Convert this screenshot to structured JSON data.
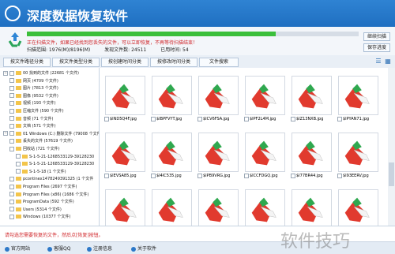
{
  "app": {
    "title": "深度数据恢复软件"
  },
  "scan": {
    "status_text": "正在扫描文件，如果已经找到您丢失的文件，可以立即恢复，不再等待扫描结束！",
    "progress_fraction": 0.75,
    "scanned_label": "扫描范围: 1976(M)/8196(M)",
    "found_label": "发现文件数: 24511",
    "time_label": "已用时间: 54",
    "stop_button": "继续扫描",
    "save_button": "保存进度"
  },
  "tabs": [
    "按文件路径分类",
    "按文件类型分类",
    "按创建时间分类",
    "按修改时间分类",
    "文件搜索"
  ],
  "tree": [
    {
      "label": "00 找到的文件  (22681 个文件)",
      "level": 0,
      "expanded": true
    },
    {
      "label": "网页  (4709 个文件)",
      "level": 1
    },
    {
      "label": "图片  (7813 个文件)",
      "level": 1
    },
    {
      "label": "图像  (9532 个文件)",
      "level": 1
    },
    {
      "label": "视频  (193 个文件)",
      "level": 1
    },
    {
      "label": "压缩文件  (590 个文件)",
      "level": 1
    },
    {
      "label": "音频  (71 个文件)",
      "level": 1
    },
    {
      "label": "文档  (571 个文件)",
      "level": 1
    },
    {
      "label": "01 Windows (C:) 删除文件 (79008 个文件)",
      "level": 0,
      "expanded": true
    },
    {
      "label": "丢失的文件  (57619 个文件)",
      "level": 1
    },
    {
      "label": "回收站  (721 个文件)",
      "level": 1
    },
    {
      "label": "S-1-5-21-1268533129-39128230",
      "level": 2
    },
    {
      "label": "S-1-5-21-1268533129-39128230",
      "level": 2
    },
    {
      "label": "S-1-5-18  (1 个文件)",
      "level": 2
    },
    {
      "label": "pcontinex1478249391325  (1 个文件",
      "level": 1
    },
    {
      "label": "Program Files  (2697 个文件)",
      "level": 1
    },
    {
      "label": "Program Files (x86)  (1686 个文件)",
      "level": 1
    },
    {
      "label": "ProgramData  (592 个文件)",
      "level": 1
    },
    {
      "label": "Users  (5314 个文件)",
      "level": 1
    },
    {
      "label": "Windows  (10377 个文件)",
      "level": 1
    }
  ],
  "files": [
    "$IND5Q4F.jpg",
    "$IBPFVYT.jpg",
    "$ICV6FSA.jpg",
    "$IPF2L4M.jpg",
    "$IZ13NXB.jpg",
    "$IPYAN71.jpg",
    "$IEVSA85.jpg",
    "$I4IC535.jpg",
    "$IPB9VRG.jpg",
    "$ICCFDGQ.jpg",
    "$I77BR44.jpg",
    "$I93EERV.jpg",
    "",
    "",
    "",
    "",
    "",
    ""
  ],
  "tip": "请勾选您需要恢复的文件，然后点[恢复]按钮。",
  "footer": [
    "官方网站",
    "客服QQ",
    "注册信息",
    "关于软件"
  ],
  "watermark": "软件技巧"
}
